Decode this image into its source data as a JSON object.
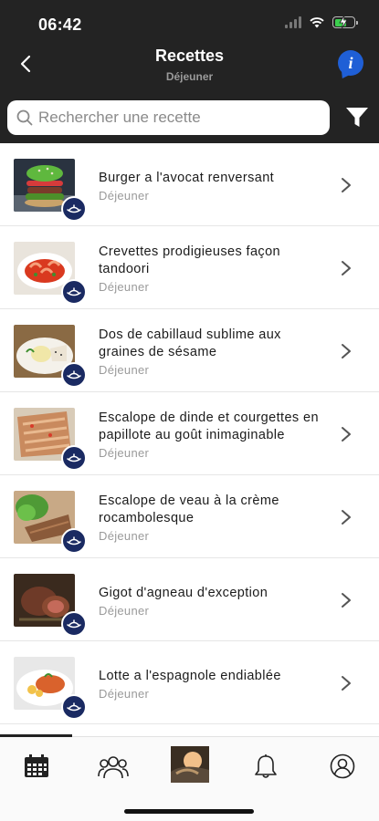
{
  "status_bar": {
    "time": "06:42"
  },
  "header": {
    "title": "Recettes",
    "subtitle": "Déjeuner"
  },
  "search": {
    "placeholder": "Rechercher une recette",
    "value": ""
  },
  "recipes": [
    {
      "title": "Burger a l'avocat renversant",
      "category": "Déjeuner"
    },
    {
      "title": "Crevettes prodigieuses façon tandoori",
      "category": "Déjeuner"
    },
    {
      "title": "Dos de cabillaud sublime aux graines de sésame",
      "category": "Déjeuner"
    },
    {
      "title": "Escalope de dinde et courgettes en papillote au goût inimaginable",
      "category": "Déjeuner"
    },
    {
      "title": "Escalope de veau à la crème rocambolesque",
      "category": "Déjeuner"
    },
    {
      "title": "Gigot d'agneau d'exception",
      "category": "Déjeuner"
    },
    {
      "title": "Lotte a l'espagnole endiablée",
      "category": "Déjeuner"
    }
  ],
  "tabbar": {
    "items": [
      "calendar-icon",
      "group-icon",
      "home-photo",
      "bell-icon",
      "profile-icon"
    ],
    "active_index": 0
  },
  "colors": {
    "header_bg": "#232323",
    "badge": "#1a2a62",
    "info": "#1f5fd6",
    "battery": "#3ccf4e"
  }
}
